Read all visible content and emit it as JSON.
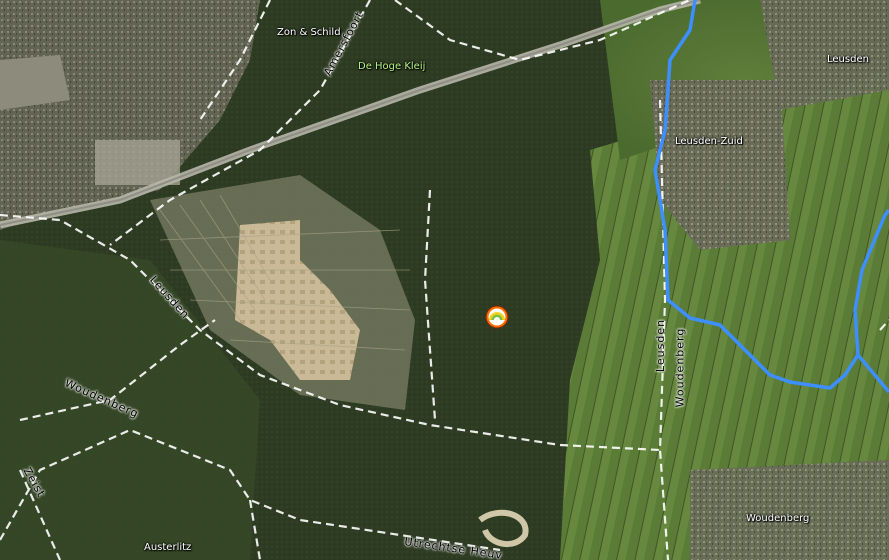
{
  "map": {
    "place_labels": {
      "zon_schild": "Zon & Schild",
      "de_hoge_kleij": "De Hoge Kleij",
      "leusden": "Leusden",
      "leusden_zuid": "Leusden-Zuid",
      "woudenberg": "Woudenberg",
      "austerlitz": "Austerlitz"
    },
    "road_labels": {
      "amersfoort": "Amersfoort",
      "leusden": "Leusden",
      "woudenberg": "Woudenberg",
      "zeist": "Zeist",
      "utrechtse_heuvelrug": "Utrechtse Heuv",
      "leusden_woudenberg_line1": "Leusden",
      "leusden_woudenberg_line2": "Woudenberg"
    },
    "marker_icon": "rainbow-location-icon",
    "colors": {
      "route": "#3d8eff",
      "dashed_road": "#ffffff",
      "marker_ring": "#ff6a00"
    }
  }
}
